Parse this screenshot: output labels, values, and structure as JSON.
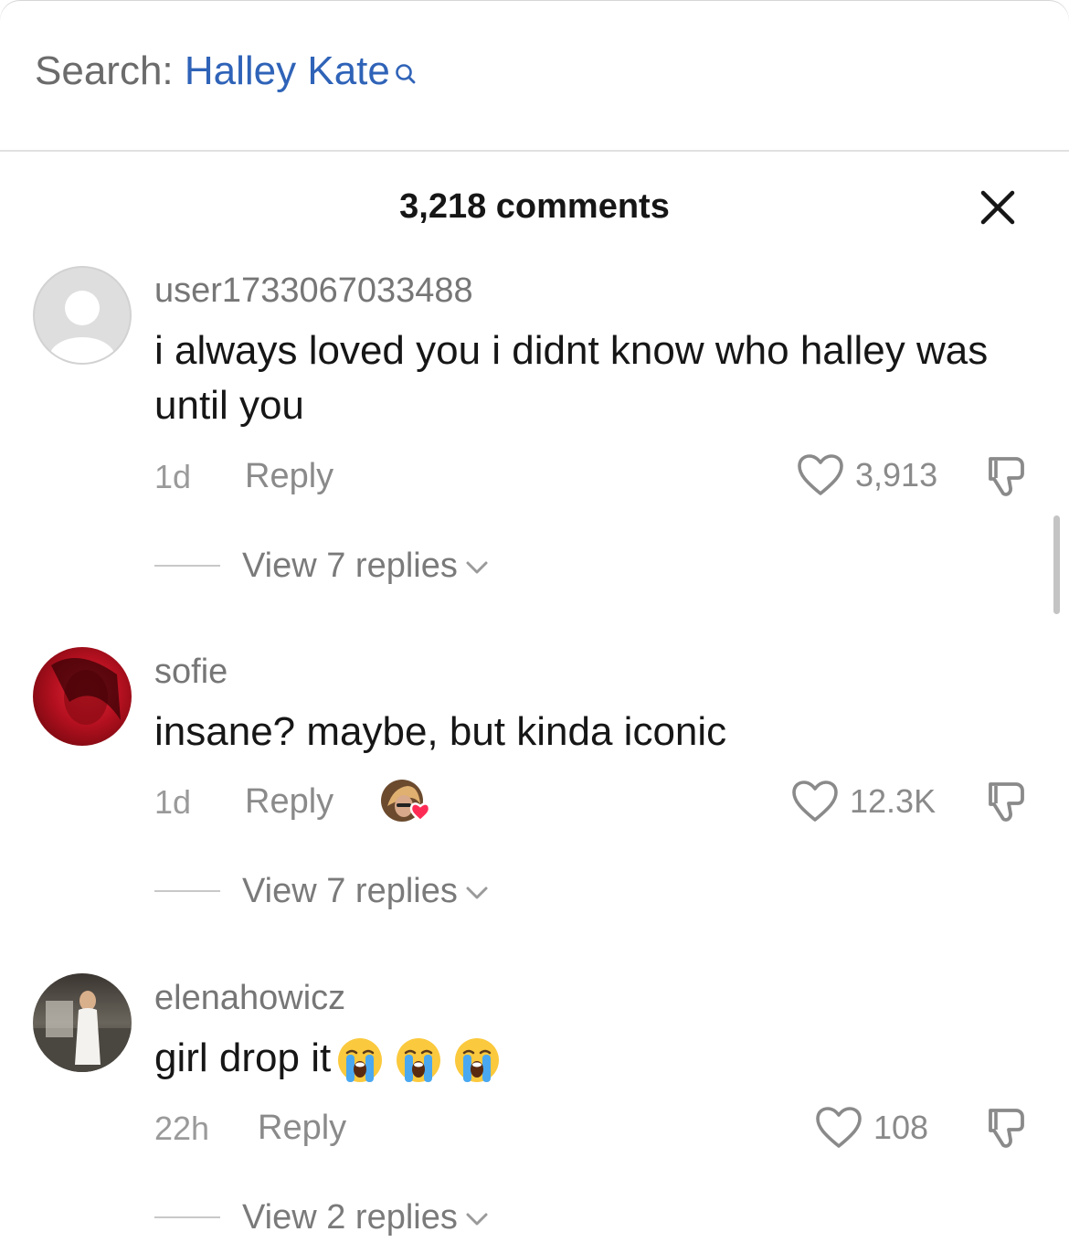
{
  "search": {
    "prefix": "Search:",
    "query": "Halley Kate"
  },
  "header": {
    "title": "3,218 comments"
  },
  "comments": [
    {
      "username": "user1733067033488",
      "text": "i always loved you i didnt know who halley was until you",
      "time": "1d",
      "reply_label": "Reply",
      "likes": "3,913",
      "view_replies": "View 7 replies"
    },
    {
      "username": "sofie",
      "text": "insane? maybe, but kinda iconic",
      "time": "1d",
      "reply_label": "Reply",
      "likes": "12.3K",
      "view_replies": "View 7 replies",
      "creator_liked": true
    },
    {
      "username": "elenahowicz",
      "text": "girl drop it",
      "emojis": [
        "loudly-crying-face",
        "loudly-crying-face",
        "loudly-crying-face"
      ],
      "time": "22h",
      "reply_label": "Reply",
      "likes": "108",
      "view_replies": "View 2 replies"
    }
  ],
  "colors": {
    "search_query": "#2f63b8",
    "heart_badge": "#fe2c55",
    "muted_text": "#8a8a8a"
  }
}
